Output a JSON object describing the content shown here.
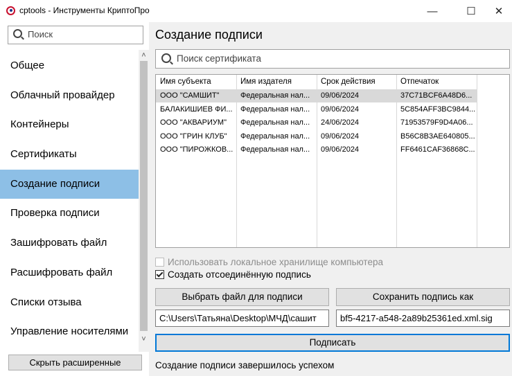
{
  "window": {
    "title": "cptools - Инструменты КриптоПро",
    "controls": {
      "minimize": "—",
      "maximize": "☐",
      "close": "✕"
    }
  },
  "sidebar": {
    "search_placeholder": "Поиск",
    "items": [
      {
        "label": "Общее"
      },
      {
        "label": "Облачный провайдер"
      },
      {
        "label": "Контейнеры"
      },
      {
        "label": "Сертификаты"
      },
      {
        "label": "Создание подписи",
        "active": true
      },
      {
        "label": "Проверка подписи"
      },
      {
        "label": "Зашифровать файл"
      },
      {
        "label": "Расшифровать файл"
      },
      {
        "label": "Списки отзыва"
      },
      {
        "label": "Управление носителями"
      }
    ],
    "scroll_up": "˄",
    "scroll_down": "˅",
    "collapse_button": "Скрыть расширенные"
  },
  "main": {
    "title": "Создание подписи",
    "cert_search_placeholder": "Поиск сертификата",
    "table": {
      "columns": [
        "Имя субъекта",
        "Имя издателя",
        "Срок действия",
        "Отпечаток"
      ],
      "rows": [
        [
          "ООО \"САМШИТ\"",
          "Федеральная нал...",
          "09/06/2024",
          "37C71BCF6A48D6..."
        ],
        [
          "БАЛАКИШИЕВ ФИ...",
          "Федеральная нал...",
          "09/06/2024",
          "5C854AFF3BC9844..."
        ],
        [
          "ООО \"АКВАРИУМ\"",
          "Федеральная нал...",
          "24/06/2024",
          "71953579F9D4A06..."
        ],
        [
          "ООО \"ГРИН КЛУБ\"",
          "Федеральная нал...",
          "09/06/2024",
          "B56C8B3AE640805..."
        ],
        [
          "ООО \"ПИРОЖКОВ...",
          "Федеральная нал...",
          "09/06/2024",
          "FF6461CAF36868C..."
        ]
      ],
      "selected_row": 0
    },
    "use_local_store_label": "Использовать локальное хранилище компьютера",
    "use_local_store_checked": false,
    "detached_label": "Создать отсоединённую подпись",
    "detached_checked": true,
    "choose_file_button": "Выбрать файл для подписи",
    "save_as_button": "Сохранить подпись как",
    "file_path": "C:\\Users\\Татьяна\\Desktop\\МЧД\\сашит",
    "output_path": "bf5-4217-a548-2a89b25361ed.xml.sig",
    "sign_button": "Подписать",
    "status": "Создание подписи завершилось успехом"
  }
}
